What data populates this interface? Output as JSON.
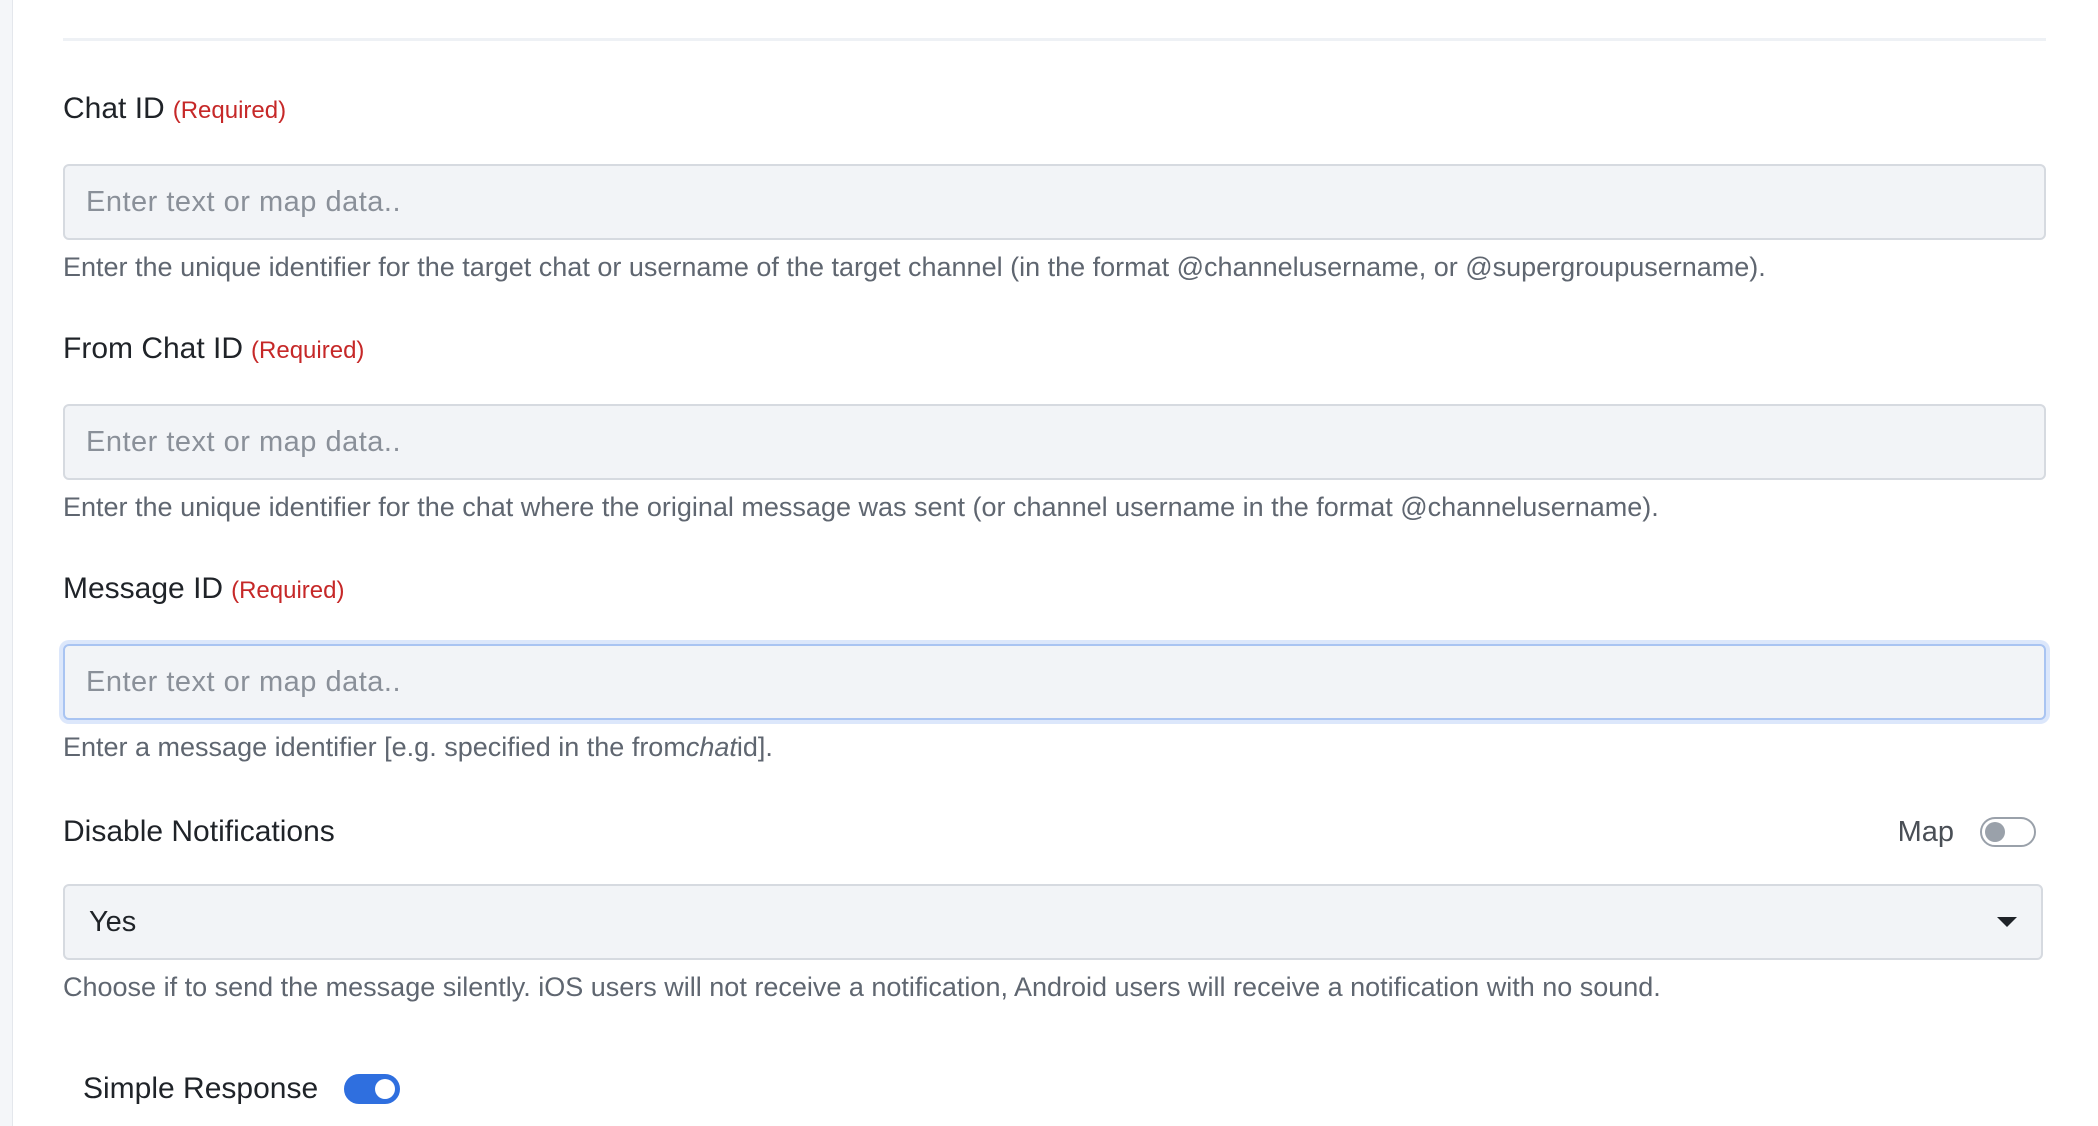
{
  "fields": [
    {
      "label": "Chat ID",
      "required": "(Required)",
      "placeholder": "Enter text or map data..",
      "value": "",
      "help": "Enter the unique identifier for the target chat or username of the target channel (in the format @channelusername, or @supergroupusername)."
    },
    {
      "label": "From Chat ID",
      "required": "(Required)",
      "placeholder": "Enter text or map data..",
      "value": "",
      "help": "Enter the unique identifier for the chat where the original message was sent (or channel username in the format @channelusername)."
    },
    {
      "label": "Message ID",
      "required": "(Required)",
      "placeholder": "Enter text or map data..",
      "value": "",
      "help_pre": "Enter a message identifier [e.g. specified in the from",
      "help_em": "chat",
      "help_post": "id]."
    }
  ],
  "disable_notifications": {
    "label": "Disable Notifications",
    "map_label": "Map",
    "map_enabled": false,
    "selected": "Yes",
    "help": "Choose if to send the message silently. iOS users will not receive a notification, Android users will receive a notification with no sound."
  },
  "simple_response": {
    "label": "Simple Response",
    "enabled": true
  },
  "colors": {
    "required": "#c62828",
    "toggle_on": "#2f6fdf",
    "focus_ring": "#dce7fb"
  }
}
